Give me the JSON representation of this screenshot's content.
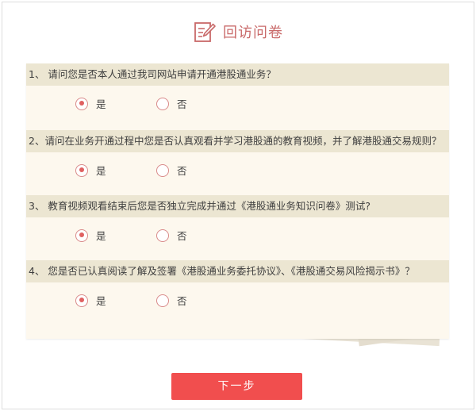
{
  "header": {
    "title": "回访问卷",
    "icon": "edit-form-icon",
    "accent_color": "#c96a6a"
  },
  "questions": [
    {
      "text": "1、 请问您是否本人通过我司网站申请开通港股通业务？",
      "options": [
        "是",
        "否"
      ],
      "selected": 0
    },
    {
      "text": "2、请问在业务开通过程中您是否认真观看并学习港股通的教育视频，并了解港股通交易规则？",
      "options": [
        "是",
        "否"
      ],
      "selected": 0
    },
    {
      "text": "3、 教育视频观看结束后您是否独立完成并通过《港股通业务知识问卷》测试?",
      "options": [
        "是",
        "否"
      ],
      "selected": 0
    },
    {
      "text": "4、 您是否已认真阅读了解及签署《港股通业务委托协议》、《港股通交易风险揭示书》？",
      "options": [
        "是",
        "否"
      ],
      "selected": 0
    }
  ],
  "next_button": {
    "label": "下一步",
    "color": "#f14e4e"
  }
}
